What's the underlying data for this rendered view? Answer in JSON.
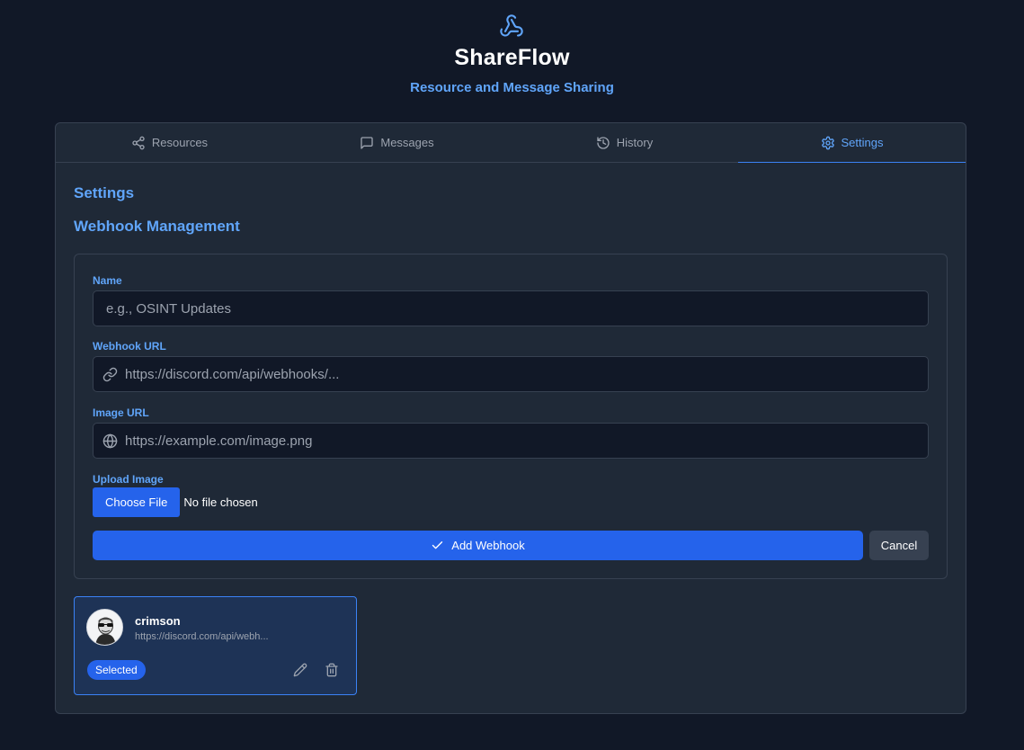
{
  "app": {
    "title": "ShareFlow",
    "subtitle": "Resource and Message Sharing",
    "logo_icon": "webhook-icon",
    "accent_color": "#60a5fa"
  },
  "tabs": [
    {
      "label": "Resources",
      "icon": "share-icon",
      "active": false
    },
    {
      "label": "Messages",
      "icon": "message-square-icon",
      "active": false
    },
    {
      "label": "History",
      "icon": "history-icon",
      "active": false
    },
    {
      "label": "Settings",
      "icon": "gear-icon",
      "active": true
    }
  ],
  "settings": {
    "title": "Settings",
    "section_title": "Webhook Management"
  },
  "form": {
    "name_label": "Name",
    "name_placeholder": "e.g., OSINT Updates",
    "name_value": "",
    "webhook_label": "Webhook URL",
    "webhook_placeholder": "https://discord.com/api/webhooks/...",
    "webhook_value": "",
    "image_label": "Image URL",
    "image_placeholder": "https://example.com/image.png",
    "image_value": "",
    "upload_label": "Upload Image",
    "choose_file_label": "Choose File",
    "file_status": "No file chosen",
    "add_button_label": "Add Webhook",
    "cancel_button_label": "Cancel"
  },
  "webhooks": [
    {
      "name": "crimson",
      "url": "https://discord.com/api/webh...",
      "badge": "Selected",
      "selected": true
    }
  ]
}
